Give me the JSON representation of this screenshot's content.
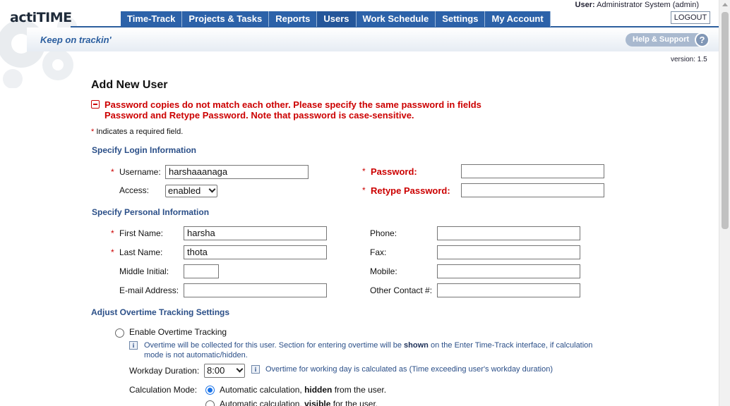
{
  "header": {
    "logo_prefix": "acti",
    "logo_suffix": "TIME",
    "tagline": "Keep on trackin'",
    "user_label": "User:",
    "user_value": "Administrator System (admin)",
    "logout": "LOGOUT",
    "help": "Help & Support",
    "help_glyph": "?",
    "version": "version: 1.5"
  },
  "nav": {
    "items": [
      "Time-Track",
      "Projects & Tasks",
      "Reports",
      "Users",
      "Work Schedule",
      "Settings",
      "My Account"
    ]
  },
  "page": {
    "title": "Add New User",
    "error": "Password copies do not match each other. Please specify the same password in fields Password and Retype Password. Note that password is case-sensitive.",
    "required_star": "*",
    "required_note": " Indicates a required field."
  },
  "login": {
    "section": "Specify Login Information",
    "username_label": "Username:",
    "username_value": "harshaaanaga",
    "access_label": "Access:",
    "access_value": "enabled",
    "password_label": "Password:",
    "password_value": "",
    "retype_label": "Retype Password:",
    "retype_value": ""
  },
  "personal": {
    "section": "Specify Personal Information",
    "first_name_label": "First Name:",
    "first_name_value": "harsha",
    "last_name_label": "Last Name:",
    "last_name_value": "thota",
    "middle_label": "Middle Initial:",
    "middle_value": "",
    "email_label": "E-mail Address:",
    "email_value": "",
    "phone_label": "Phone:",
    "phone_value": "",
    "fax_label": "Fax:",
    "fax_value": "",
    "mobile_label": "Mobile:",
    "mobile_value": "",
    "other_label": "Other Contact #:",
    "other_value": ""
  },
  "overtime": {
    "section": "Adjust Overtime Tracking Settings",
    "enable_label": "Enable Overtime Tracking",
    "info_1_a": "Overtime will be collected for this user. Section for entering overtime will be ",
    "info_1_b": "shown",
    "info_1_c": " on the Enter Time-Track interface, if calculation mode is not automatic/hidden.",
    "workday_label": "Workday Duration:",
    "workday_value": "8:00",
    "info_2": "Overtime for working day is calculated as (Time exceeding user's workday duration)",
    "calc_label": "Calculation Mode:",
    "calc_option_1_a": "Automatic calculation, ",
    "calc_option_1_b": "hidden",
    "calc_option_1_c": " from the user.",
    "calc_option_2_a": "Automatic calculation, ",
    "calc_option_2_b": "visible",
    "calc_option_2_c": " for the user."
  },
  "colors": {
    "nav": "#2c62a9",
    "error": "#cc0000",
    "section": "#2b4f88"
  }
}
